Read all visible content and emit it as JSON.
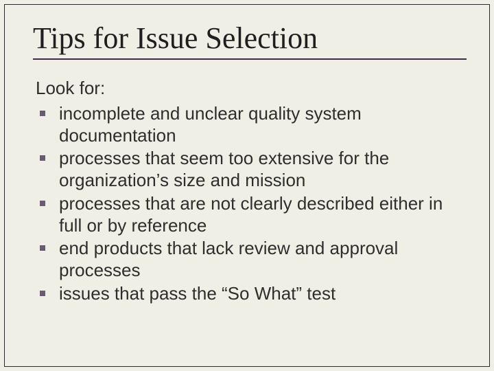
{
  "slide": {
    "title": "Tips for Issue Selection",
    "lead": "Look for:",
    "bullets": [
      "incomplete and unclear quality system documentation",
      "processes that seem too extensive for the organization’s size and mission",
      "processes that are not clearly described either in full or by reference",
      "end products that lack review and approval processes",
      " issues that pass the “So What” test"
    ]
  }
}
